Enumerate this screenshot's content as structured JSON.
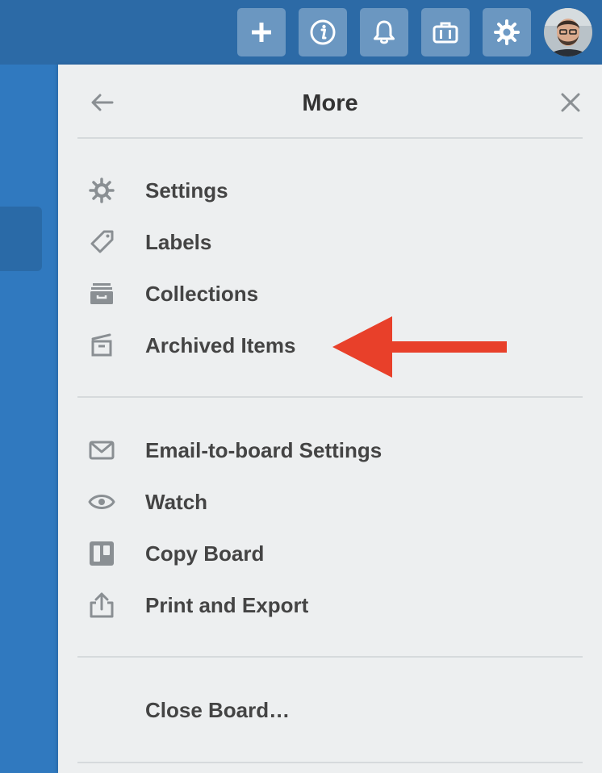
{
  "header": {
    "buttons": [
      {
        "name": "add-button",
        "icon": "plus-icon"
      },
      {
        "name": "info-button",
        "icon": "info-icon"
      },
      {
        "name": "notifications-button",
        "icon": "bell-icon"
      },
      {
        "name": "boards-button",
        "icon": "briefcase-icon"
      },
      {
        "name": "settings-button",
        "icon": "gear-icon"
      }
    ],
    "avatar": "user-avatar"
  },
  "panel": {
    "title": "More",
    "back_icon": "arrow-left-icon",
    "close_icon": "close-icon",
    "sections": [
      {
        "items": [
          {
            "label": "Settings",
            "icon": "gear-icon"
          },
          {
            "label": "Labels",
            "icon": "tag-icon"
          },
          {
            "label": "Collections",
            "icon": "collection-icon"
          },
          {
            "label": "Archived Items",
            "icon": "archive-icon"
          }
        ]
      },
      {
        "items": [
          {
            "label": "Email-to-board Settings",
            "icon": "email-icon"
          },
          {
            "label": "Watch",
            "icon": "eye-icon"
          },
          {
            "label": "Copy Board",
            "icon": "board-icon"
          },
          {
            "label": "Print and Export",
            "icon": "share-icon"
          }
        ]
      },
      {
        "items": [
          {
            "label": "Close Board…"
          }
        ]
      }
    ]
  },
  "annotation": {
    "icon": "red-arrow-icon",
    "color": "#e8402a",
    "points_to": "Archived Items"
  },
  "colors": {
    "header": "#2c6aa6",
    "board": "#3079bf",
    "panel": "#edeff0",
    "icon": "#8a8f93",
    "text": "#444444"
  }
}
